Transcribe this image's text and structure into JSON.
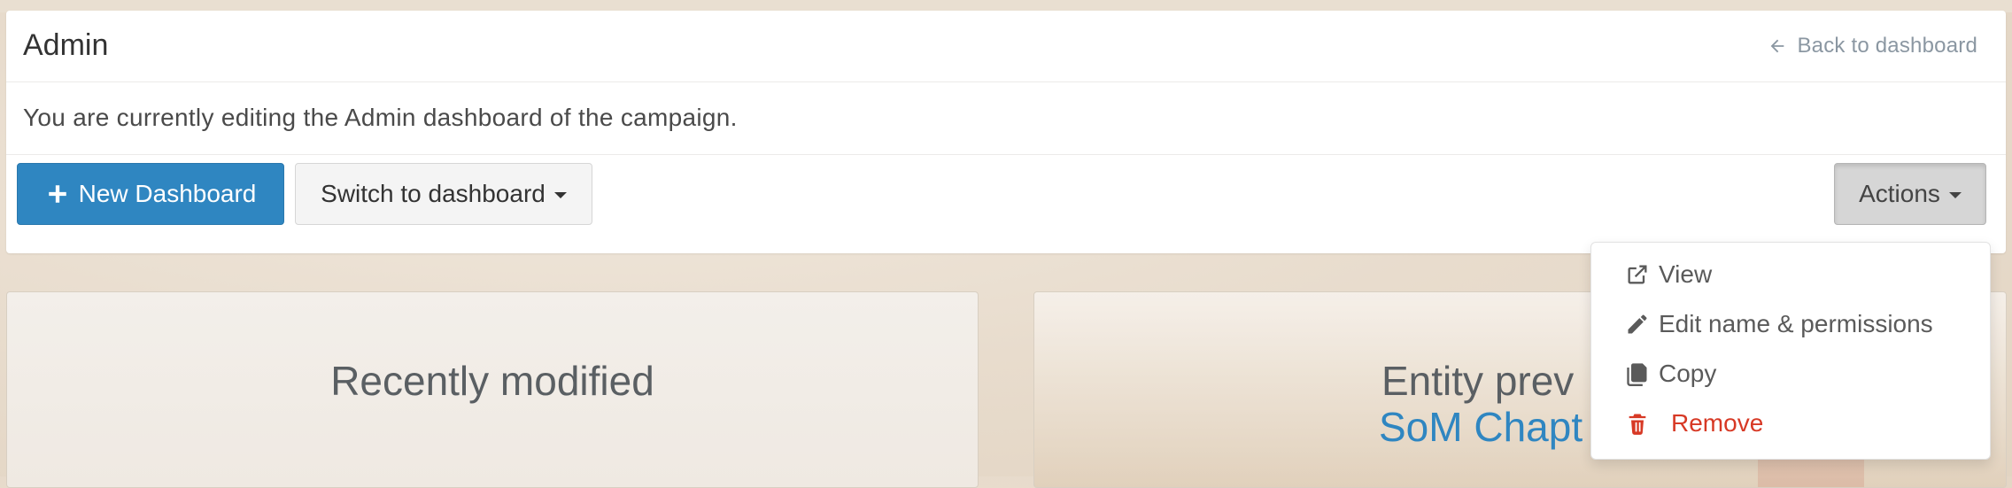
{
  "header": {
    "title": "Admin",
    "back_link": "Back to dashboard"
  },
  "description": "You are currently editing the Admin dashboard of the campaign.",
  "toolbar": {
    "new_dashboard": "New Dashboard",
    "switch_dashboard": "Switch to dashboard",
    "actions": "Actions"
  },
  "actions_menu": {
    "items": [
      {
        "label": "View",
        "icon": "external-link-icon"
      },
      {
        "label": "Edit name & permissions",
        "icon": "pencil-icon"
      },
      {
        "label": "Copy",
        "icon": "copy-icon"
      },
      {
        "label": "Remove",
        "icon": "trash-icon"
      }
    ]
  },
  "widgets": {
    "recent": {
      "title": "Recently modified"
    },
    "entity": {
      "title": "Entity prev",
      "link": "SoM Chapt"
    }
  },
  "colors": {
    "primary": "#2f86c1",
    "danger": "#d73925",
    "muted_link": "#8b97a2"
  }
}
